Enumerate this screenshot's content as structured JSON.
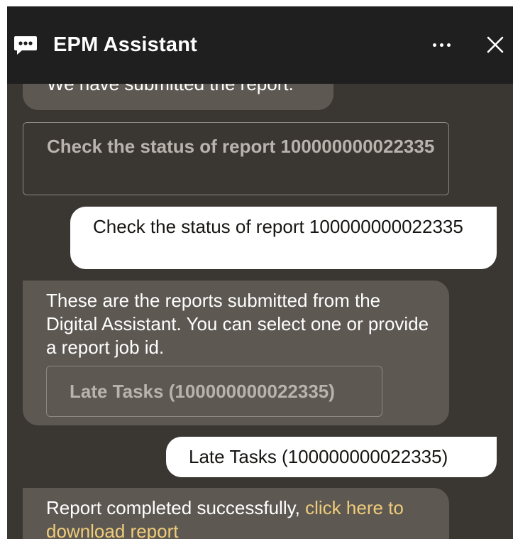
{
  "header": {
    "title": "EPM Assistant",
    "chat_icon": "chat-bubble-icon",
    "more_icon": "more-horizontal-icon",
    "close_icon": "close-icon"
  },
  "messages": {
    "previous_bot_text": "We have submitted the report.",
    "check_status_button": "Check the status of report 100000000022335",
    "user_message_1": "Check the status of report 100000000022335",
    "bot_reports_text": "These are the reports submitted from the Digital Assistant. You can select one or provide a report job id.",
    "late_tasks_button": "Late Tasks (100000000022335)",
    "user_message_2": "Late Tasks (100000000022335)",
    "completion_text": "Report completed successfully, ",
    "completion_link": "click here to download report"
  },
  "colors": {
    "header_bg": "#1f1f1f",
    "panel_bg": "#3a3632",
    "bot_bubble": "#5d5852",
    "user_bubble": "#ffffff",
    "link": "#f0cc7a"
  }
}
